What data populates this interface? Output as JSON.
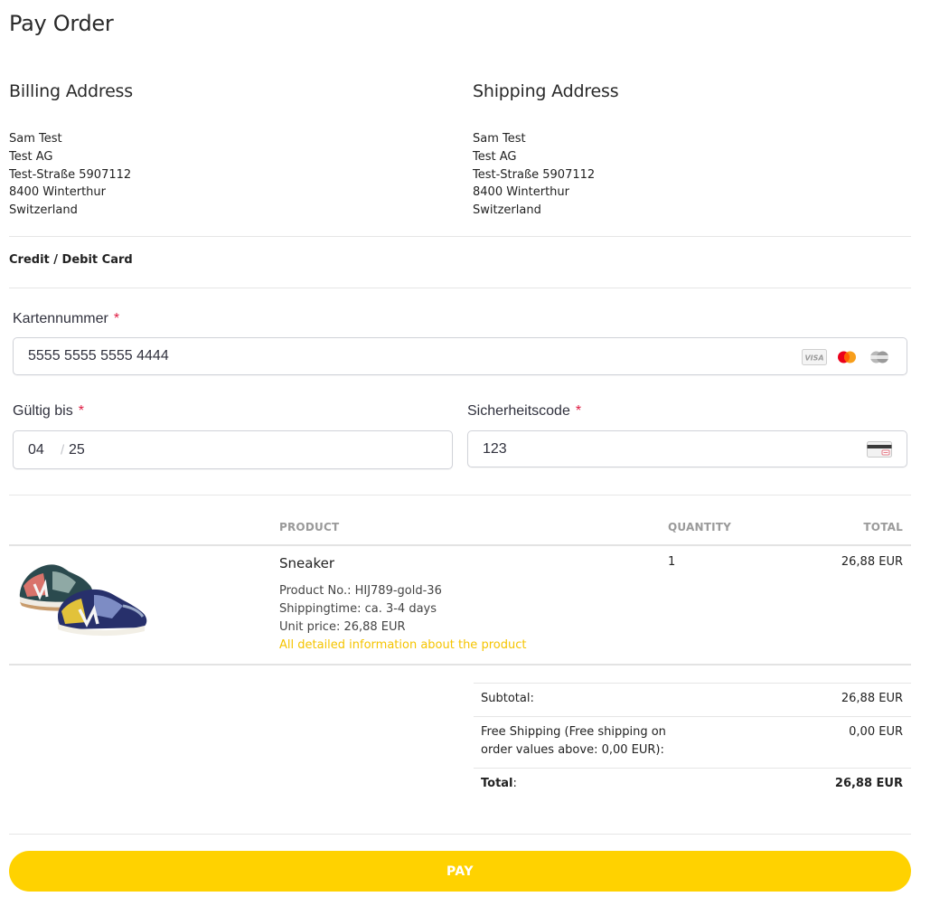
{
  "page": {
    "title": "Pay Order"
  },
  "billing": {
    "heading": "Billing Address",
    "lines": [
      "Sam Test",
      "Test AG",
      "Test-Straße 5907112",
      "8400 Winterthur",
      "Switzerland"
    ]
  },
  "shipping": {
    "heading": "Shipping Address",
    "lines": [
      "Sam Test",
      "Test AG",
      "Test-Straße 5907112",
      "8400 Winterthur",
      "Switzerland"
    ]
  },
  "payment": {
    "method": "Credit / Debit Card",
    "card_number": {
      "label": "Kartennummer",
      "required": "*",
      "value": "5555 5555 5555 4444",
      "brands": [
        "visa-icon",
        "mastercard-icon",
        "maestro-icon"
      ]
    },
    "expiry": {
      "label": "Gültig bis",
      "required": "*",
      "month": "04",
      "separator": "/",
      "year": "25"
    },
    "cvc": {
      "label": "Sicherheitscode",
      "required": "*",
      "value": "123",
      "icon": "card-cvc-icon"
    }
  },
  "table": {
    "headers": {
      "product": "PRODUCT",
      "quantity": "QUANTITY",
      "total": "TOTAL"
    },
    "rows": [
      {
        "name": "Sneaker",
        "product_no": "Product No.: HIJ789-gold-36",
        "shipping_time": "Shippingtime: ca. 3-4 days",
        "unit_price": "Unit price: 26,88 EUR",
        "details_link": "All detailed information about the product",
        "quantity": "1",
        "total": "26,88 EUR"
      }
    ]
  },
  "summary": {
    "subtotal_label": "Subtotal:",
    "subtotal_value": "26,88 EUR",
    "shipping_label_line1": "Free Shipping (Free shipping on",
    "shipping_label_line2": "order values above: 0,00 EUR):",
    "shipping_value": "0,00 EUR",
    "total_label": "Total",
    "total_colon": ":",
    "total_value": "26,88 EUR"
  },
  "actions": {
    "pay_label": "PAY"
  },
  "colors": {
    "accent": "#ffd200",
    "link": "#f5c400",
    "required": "#df1b41"
  }
}
